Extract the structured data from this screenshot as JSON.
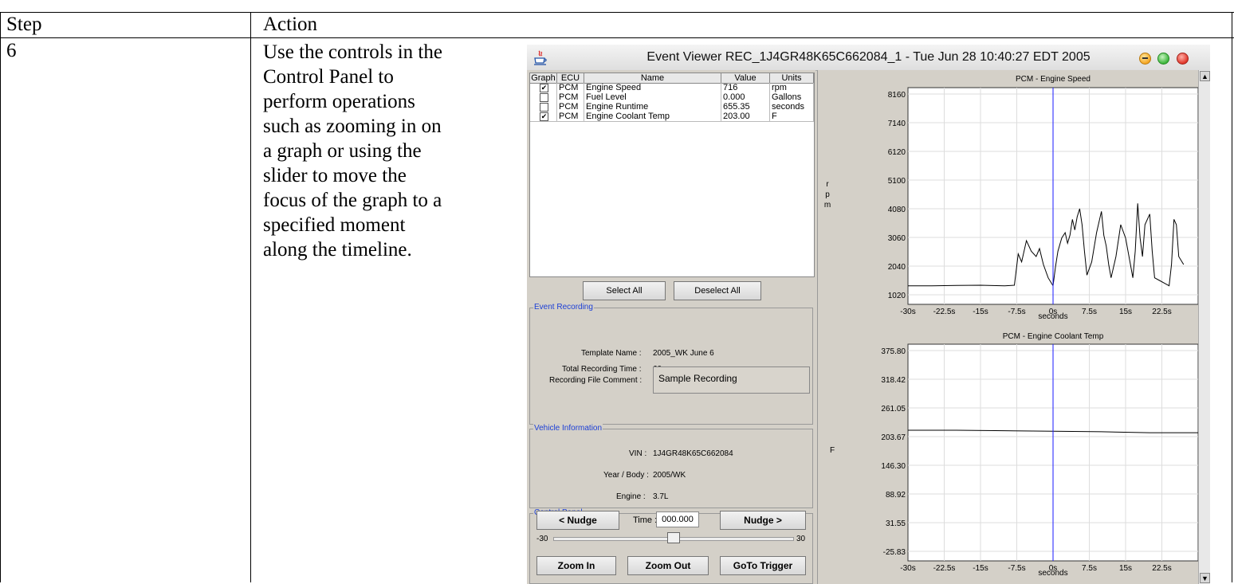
{
  "table": {
    "header_step": "Step",
    "header_action": "Action",
    "step": "6",
    "action_lines": [
      "Use the controls in the",
      "Control Panel to",
      "perform operations",
      "such as zooming in on",
      "a graph or using the",
      "slider to move the",
      "focus of the graph to a",
      "specified moment",
      "along the timeline."
    ]
  },
  "window": {
    "title": "Event Viewer REC_1J4GR48K65C662084_1 - Tue Jun 28 10:40:27 EDT 2005"
  },
  "signals": {
    "headers": [
      "Graph",
      "ECU",
      "Name",
      "Value",
      "Units"
    ],
    "rows": [
      {
        "checked": true,
        "ecu": "PCM",
        "name": "Engine Speed",
        "value": "716",
        "units": "rpm"
      },
      {
        "checked": false,
        "ecu": "PCM",
        "name": "Fuel Level",
        "value": "0.000",
        "units": "Gallons"
      },
      {
        "checked": false,
        "ecu": "PCM",
        "name": "Engine Runtime",
        "value": "655.35",
        "units": "seconds"
      },
      {
        "checked": true,
        "ecu": "PCM",
        "name": "Engine Coolant Temp",
        "value": "203.00",
        "units": "F"
      }
    ],
    "select_all": "Select All",
    "deselect_all": "Deselect All"
  },
  "event_recording": {
    "label": "Event Recording",
    "template_label": "Template Name :",
    "template_value": "2005_WK June 6",
    "total_time_label": "Total Recording Time :",
    "total_time_value": "60",
    "comment_label": "Recording File Comment :",
    "comment_value": "Sample Recording"
  },
  "vehicle": {
    "label": "Vehicle Information",
    "vin_label": "VIN :",
    "vin_value": "1J4GR48K65C662084",
    "year_label": "Year / Body :",
    "year_value": "2005/WK",
    "engine_label": "Engine :",
    "engine_value": "3.7L"
  },
  "control_panel": {
    "label": "Control Panel",
    "nudge_left": "< Nudge",
    "time_label": "Time :",
    "time_value": "000.000",
    "nudge_right": "Nudge >",
    "slider_min": "-30",
    "slider_max": "30",
    "slider_value": 0,
    "zoom_in": "Zoom In",
    "zoom_out": "Zoom Out",
    "goto_trigger": "GoTo Trigger"
  },
  "chart_data": [
    {
      "type": "line",
      "title": "PCM - Engine Speed",
      "ylabel": "rpm",
      "xlabel": "seconds",
      "x_ticks": [
        "-30s",
        "-22.5s",
        "-15s",
        "-7.5s",
        "0s",
        "7.5s",
        "15s",
        "22.5s"
      ],
      "y_ticks": [
        "8160",
        "7140",
        "6120",
        "5100",
        "4080",
        "3060",
        "2040",
        "1020"
      ],
      "xlim": [
        -30,
        30
      ],
      "ylim": [
        0,
        8160
      ],
      "cursor_x": 0,
      "color": "#000000",
      "cursor_color": "#1a1aff",
      "series": [
        {
          "x": [
            -30,
            -25,
            -20,
            -15,
            -10,
            -8,
            -7.2,
            -6.5,
            -5.5,
            -4.5,
            -3.5,
            -2.8,
            -2,
            -1,
            0,
            0.5,
            1,
            1.8,
            2.5,
            3,
            3.5,
            4,
            4.5,
            5,
            5.5,
            6,
            6.5,
            7,
            8,
            9,
            10,
            10.5,
            11,
            11.5,
            12,
            13,
            14,
            15,
            16,
            16.5,
            17,
            17.5,
            18,
            18.5,
            19,
            20,
            20.5,
            21,
            22,
            23,
            24,
            24.5,
            25,
            25.5,
            26,
            27
          ],
          "y": [
            700,
            700,
            710,
            720,
            700,
            720,
            1900,
            1600,
            2400,
            2000,
            1800,
            2100,
            1500,
            1000,
            700,
            1400,
            2000,
            2500,
            2700,
            2300,
            2600,
            3200,
            2800,
            3300,
            3600,
            3000,
            2000,
            1100,
            1600,
            2700,
            3500,
            2600,
            2200,
            1500,
            1000,
            1800,
            3000,
            2500,
            1500,
            1000,
            2000,
            3800,
            2500,
            1800,
            3000,
            3400,
            2000,
            1000,
            900,
            800,
            700,
            1500,
            3200,
            3000,
            1800,
            1500
          ]
        }
      ]
    },
    {
      "type": "line",
      "title": "PCM - Engine Coolant Temp",
      "ylabel": "F",
      "xlabel": "seconds",
      "x_ticks": [
        "-30s",
        "-22.5s",
        "-15s",
        "-7.5s",
        "0s",
        "7.5s",
        "15s",
        "22.5s"
      ],
      "y_ticks": [
        "375.80",
        "318.42",
        "261.05",
        "203.67",
        "146.30",
        "88.92",
        "31.55",
        "-25.83"
      ],
      "xlim": [
        -30,
        30
      ],
      "ylim": [
        -54.52,
        375.8
      ],
      "cursor_x": 0,
      "color": "#000000",
      "cursor_color": "#1a1aff",
      "series": [
        {
          "x": [
            -30,
            -20,
            -10,
            0,
            10,
            20,
            30
          ],
          "y": [
            205,
            205,
            204,
            203,
            202,
            200,
            200
          ]
        }
      ]
    }
  ]
}
